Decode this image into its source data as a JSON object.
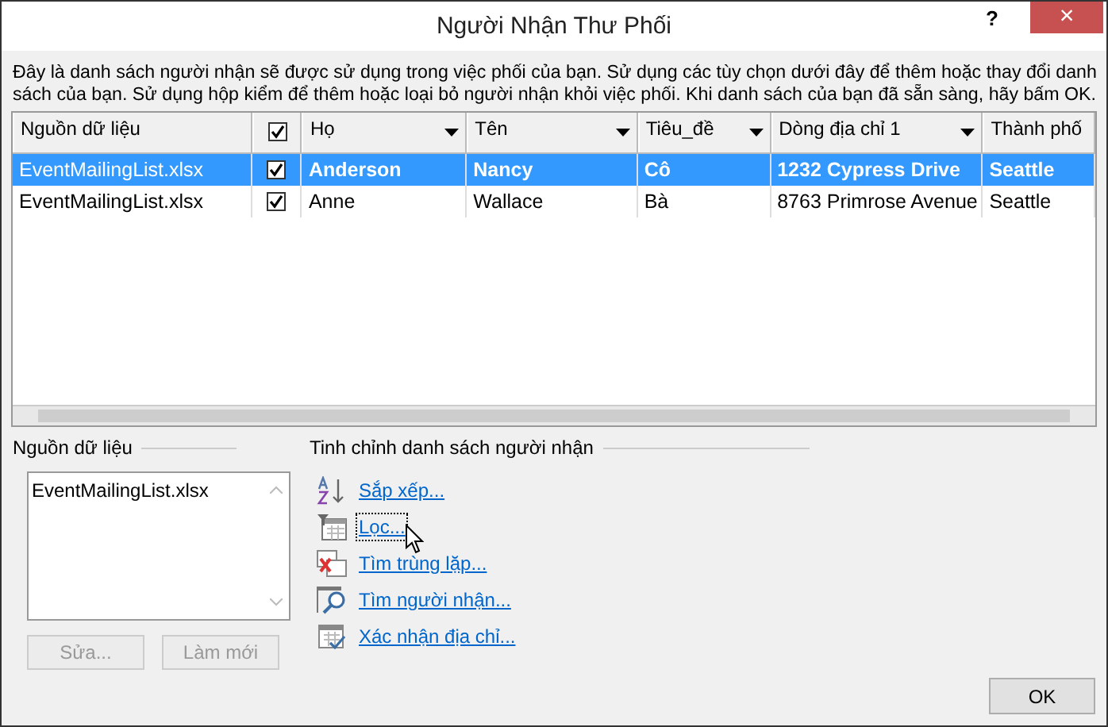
{
  "window": {
    "title": "Người Nhận Thư Phối",
    "help": "?",
    "close": "×"
  },
  "description": "Đây là danh sách người nhận sẽ được sử dụng trong việc phối của bạn. Sử dụng các tùy chọn dưới đây để thêm hoặc thay đổi danh sách của bạn. Sử dụng hộp kiểm để thêm hoặc loại bỏ người nhận khỏi việc phối. Khi danh sách của bạn đã sẵn sàng, hãy bấm OK.",
  "table": {
    "select_all": {
      "checked": true
    },
    "columns": [
      {
        "label": "Nguồn dữ liệu",
        "dropdown": false
      },
      {
        "label": "Họ",
        "dropdown": true
      },
      {
        "label": "Tên",
        "dropdown": true
      },
      {
        "label": "Tiêu_đề",
        "dropdown": true
      },
      {
        "label": "Dòng địa chỉ 1",
        "dropdown": true
      },
      {
        "label": "Thành phố",
        "dropdown": false
      }
    ],
    "rows": [
      {
        "selected": true,
        "checked": true,
        "cells": [
          "EventMailingList.xlsx",
          "Anderson",
          "Nancy",
          "Cô",
          "1232 Cypress Drive",
          "Seattle"
        ]
      },
      {
        "selected": false,
        "checked": true,
        "cells": [
          "EventMailingList.xlsx",
          "Anne",
          "Wallace",
          "Bà",
          "8763 Primrose Avenue",
          "Seattle"
        ]
      }
    ]
  },
  "data_source": {
    "label": "Nguồn dữ liệu",
    "items": [
      "EventMailingList.xlsx"
    ],
    "buttons": [
      {
        "label": "Sửa...",
        "disabled": true
      },
      {
        "label": "Làm mới",
        "disabled": true
      }
    ]
  },
  "refine": {
    "label": "Tinh chỉnh danh sách người nhận",
    "links": [
      {
        "kind": "sort",
        "label": "Sắp xếp...",
        "focused": false
      },
      {
        "kind": "filter",
        "label": "Lọc...",
        "focused": true
      },
      {
        "kind": "duplicates",
        "label": "Tìm trùng lặp...",
        "focused": false
      },
      {
        "kind": "find",
        "label": "Tìm người nhận...",
        "focused": false
      },
      {
        "kind": "validate",
        "label": "Xác nhận địa chỉ...",
        "focused": false
      }
    ]
  },
  "ok_button": "OK"
}
